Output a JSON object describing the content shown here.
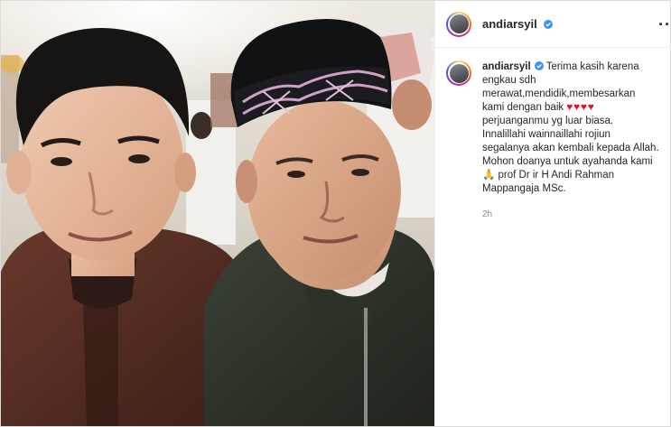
{
  "post": {
    "username": "andiarsyil",
    "more_icon": "more-horizontal-icon",
    "verified_icon": "verified-badge-icon",
    "photo_description_icon": "selfie-photo"
  },
  "caption": {
    "username": "andiarsyil",
    "first": "Terima kasih karena",
    "lines": [
      "engkau sdh",
      "merawat,mendidik,membesarkan",
      "kami dengan baik",
      "perjuanganmu yg luar biasa.",
      "Innalillahi wainnaillahi rojiun",
      "segalanya akan kembali kepada Allah.",
      "Mohon doanya untuk ayahanda kami",
      "prof Dr ir H Andi Rahman",
      "Mappangaja MSc."
    ],
    "hearts": "♥♥♥♥",
    "pray": "🙏",
    "time": "2h"
  },
  "colors": {
    "verified": "#3897f0",
    "heart": "#e0112b",
    "muted": "#8e8e8e"
  }
}
